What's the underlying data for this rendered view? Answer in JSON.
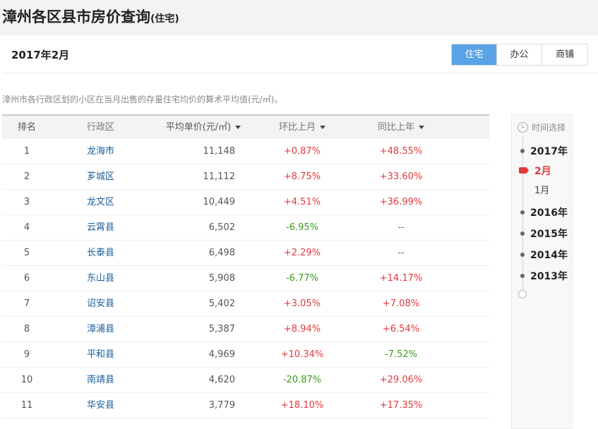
{
  "header": {
    "title": "漳州各区县市房价查询",
    "subtitle": "(住宅)"
  },
  "month_bar": {
    "current": "2017年2月",
    "tabs": [
      {
        "label": "住宅",
        "active": true
      },
      {
        "label": "办公",
        "active": false
      },
      {
        "label": "商铺",
        "active": false
      }
    ]
  },
  "description": "漳州市各行政区划的小区在当月出售的存量住宅均价的算术平均值(元/㎡)。",
  "table": {
    "headers": {
      "rank": "排名",
      "district": "行政区",
      "price": "平均单价(元/㎡)",
      "mom": "环比上月",
      "yoy": "同比上年"
    },
    "rows": [
      {
        "rank": "1",
        "district": "龙海市",
        "price": "11,148",
        "mom": "+0.87%",
        "yoy": "+48.55%"
      },
      {
        "rank": "2",
        "district": "芗城区",
        "price": "11,112",
        "mom": "+8.75%",
        "yoy": "+33.60%"
      },
      {
        "rank": "3",
        "district": "龙文区",
        "price": "10,449",
        "mom": "+4.51%",
        "yoy": "+36.99%"
      },
      {
        "rank": "4",
        "district": "云霄县",
        "price": "6,502",
        "mom": "-6.95%",
        "yoy": "--"
      },
      {
        "rank": "5",
        "district": "长泰县",
        "price": "6,498",
        "mom": "+2.29%",
        "yoy": "--"
      },
      {
        "rank": "6",
        "district": "东山县",
        "price": "5,908",
        "mom": "-6.77%",
        "yoy": "+14.17%"
      },
      {
        "rank": "7",
        "district": "诏安县",
        "price": "5,402",
        "mom": "+3.05%",
        "yoy": "+7.08%"
      },
      {
        "rank": "8",
        "district": "漳浦县",
        "price": "5,387",
        "mom": "+8.94%",
        "yoy": "+6.54%"
      },
      {
        "rank": "9",
        "district": "平和县",
        "price": "4,969",
        "mom": "+10.34%",
        "yoy": "-7.52%"
      },
      {
        "rank": "10",
        "district": "南靖县",
        "price": "4,620",
        "mom": "-20.87%",
        "yoy": "+29.06%"
      },
      {
        "rank": "11",
        "district": "华安县",
        "price": "3,779",
        "mom": "+18.10%",
        "yoy": "+17.35%"
      }
    ]
  },
  "timeline": {
    "title": "时间选择",
    "years": [
      "2017年",
      "2016年",
      "2015年",
      "2014年",
      "2013年"
    ],
    "months_2017": [
      "2月",
      "1月"
    ],
    "active_month": "2月"
  },
  "colors": {
    "accent": "#5aa3e6",
    "increase": "#e4393c",
    "decrease": "#3d9a1d",
    "link": "#1a5e9c"
  }
}
